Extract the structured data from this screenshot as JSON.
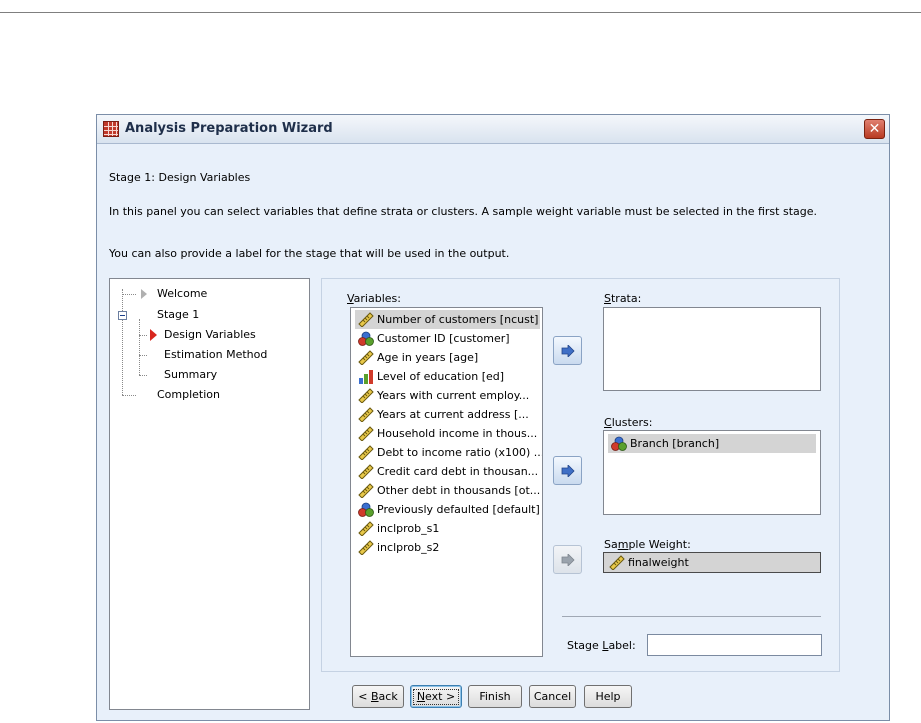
{
  "window": {
    "title": "Analysis Preparation Wizard",
    "close_symbol": "✕",
    "icon": "spreadsheet-grid-icon"
  },
  "content": {
    "stage_heading": "Stage 1: Design Variables",
    "description1": "In this panel you can select variables that define strata or clusters. A sample weight variable must be selected in the first stage.",
    "description2": "You can also provide a label for the stage that will be used in the output."
  },
  "nav": {
    "items": [
      {
        "label": "Welcome"
      },
      {
        "label": "Stage 1"
      },
      {
        "label": "Design Variables",
        "current": true
      },
      {
        "label": "Estimation Method"
      },
      {
        "label": "Summary"
      },
      {
        "label": "Completion"
      }
    ]
  },
  "variables": {
    "label_pre": "",
    "label_mn": "V",
    "label_post": "ariables:",
    "items": [
      {
        "label": "Number of customers [ncust]",
        "icon": "scale-ruler-icon",
        "selected": true
      },
      {
        "label": "Customer ID [customer]",
        "icon": "nominal-icon"
      },
      {
        "label": "Age in years [age]",
        "icon": "scale-ruler-icon"
      },
      {
        "label": "Level of education [ed]",
        "icon": "ordinal-icon"
      },
      {
        "label": "Years with current employ...",
        "icon": "scale-ruler-icon"
      },
      {
        "label": "Years at current address [...",
        "icon": "scale-ruler-icon"
      },
      {
        "label": "Household income in thous...",
        "icon": "scale-ruler-icon"
      },
      {
        "label": "Debt to income ratio (x100) ...",
        "icon": "scale-ruler-icon"
      },
      {
        "label": "Credit card debt in thousan...",
        "icon": "scale-ruler-icon"
      },
      {
        "label": "Other debt in thousands [ot...",
        "icon": "scale-ruler-icon"
      },
      {
        "label": "Previously defaulted [default]",
        "icon": "nominal-icon"
      },
      {
        "label": "inclprob_s1",
        "icon": "scale-ruler-icon"
      },
      {
        "label": "inclprob_s2",
        "icon": "scale-ruler-icon"
      }
    ]
  },
  "strata": {
    "label_pre": "",
    "label_mn": "S",
    "label_post": "trata:"
  },
  "clusters": {
    "label_pre": "",
    "label_mn": "C",
    "label_post": "lusters:",
    "items": [
      {
        "label": "Branch [branch]",
        "icon": "nominal-icon"
      }
    ]
  },
  "sample_weight": {
    "label_pre": "Sa",
    "label_mn": "m",
    "label_post": "ple Weight:",
    "value": "finalweight",
    "icon": "scale-ruler-icon"
  },
  "stage_label": {
    "label_pre": "Stage ",
    "label_mn": "L",
    "label_post": "abel:",
    "value": ""
  },
  "buttons": {
    "back": {
      "pre": "< ",
      "mn": "B",
      "post": "ack"
    },
    "next": {
      "pre": "",
      "mn": "N",
      "post": "ext >"
    },
    "finish": {
      "label": "Finish"
    },
    "cancel": {
      "label": "Cancel"
    },
    "help": {
      "label": "Help"
    }
  },
  "colors": {
    "dialog_bg": "#e8f0fa",
    "close_button": "#c8452e",
    "arrow_button": "#3f6fc6",
    "current_step_marker": "#d8261e"
  }
}
